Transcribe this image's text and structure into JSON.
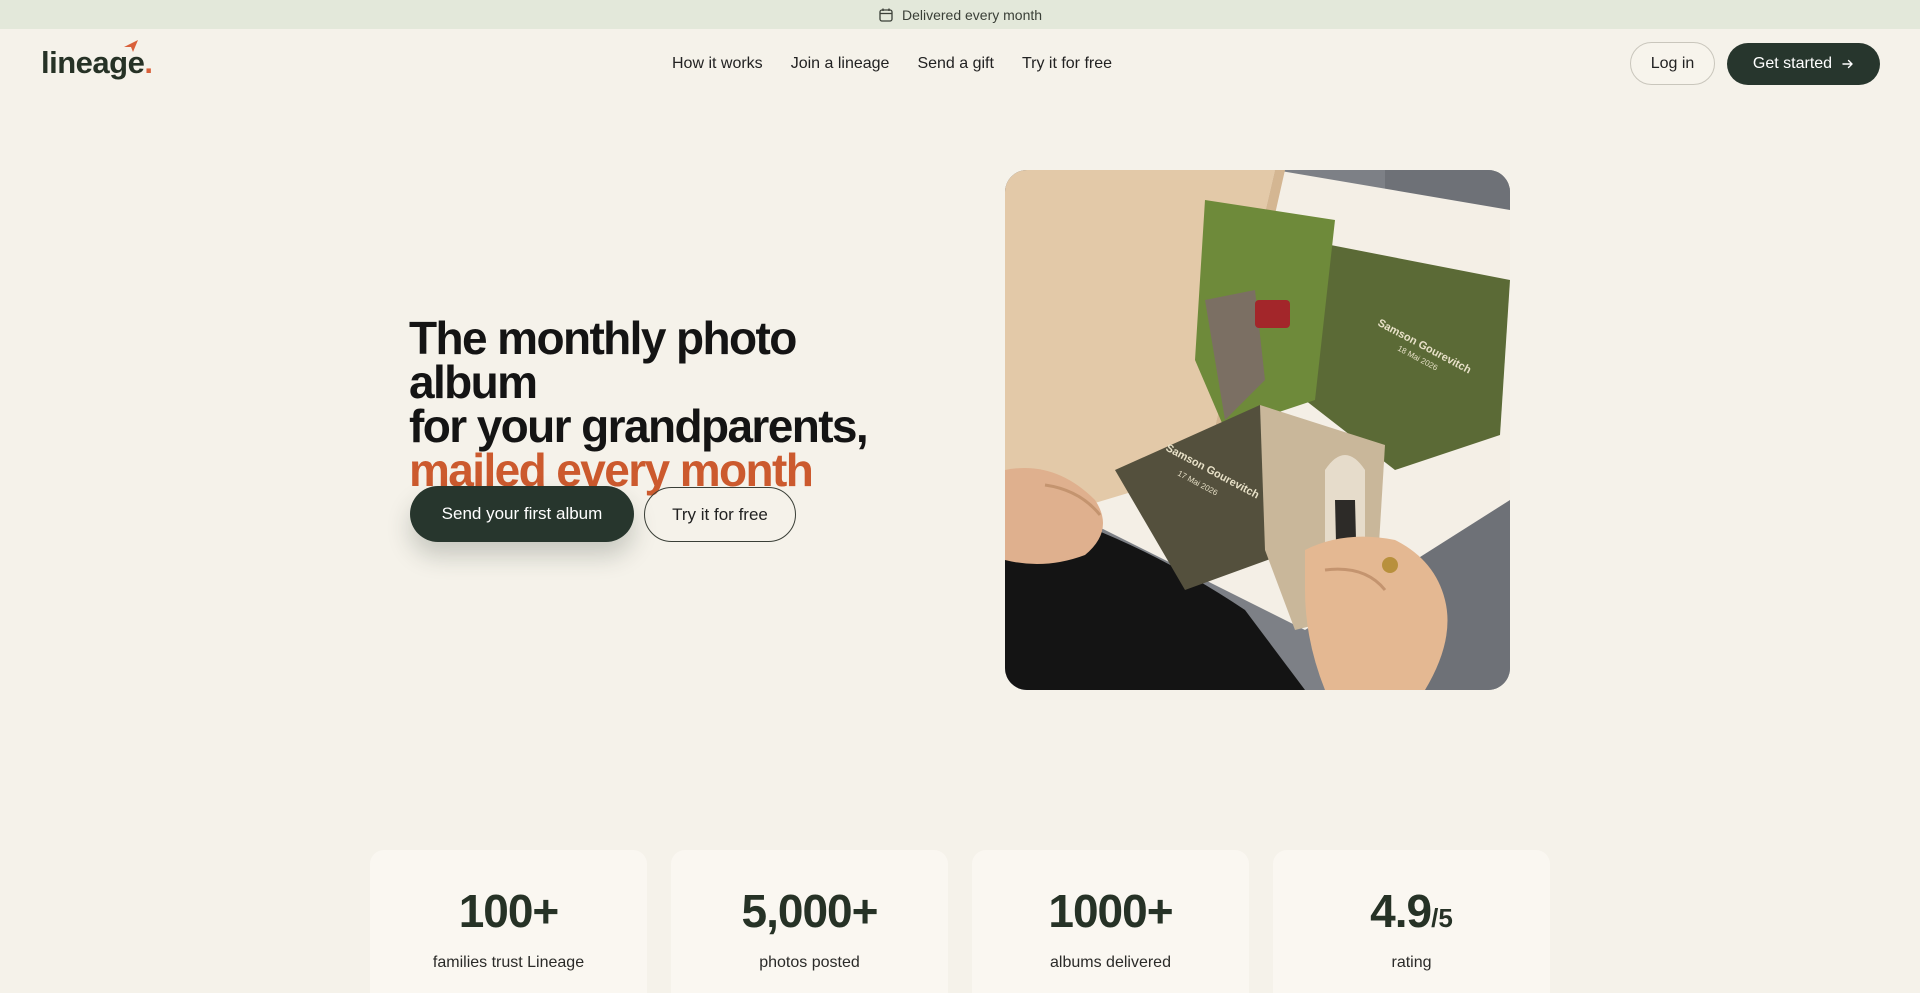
{
  "announcement": {
    "icon": "calendar-icon",
    "text": "Delivered every month"
  },
  "header": {
    "logo_text": "lineage",
    "logo_dot": ".",
    "nav": [
      {
        "label": "How it works"
      },
      {
        "label": "Join a lineage"
      },
      {
        "label": "Send a gift"
      },
      {
        "label": "Try it for free"
      }
    ],
    "login_label": "Log in",
    "get_started_label": "Get started"
  },
  "hero": {
    "title_line1": "The monthly photo album",
    "title_line2": "for your grandparents,",
    "title_accent": "mailed every month",
    "primary_cta": "Send your first album",
    "secondary_cta": "Try it for free",
    "image": {
      "album_name_1": "Samson Gourevitch",
      "album_date_1": "18 Mai 2026",
      "album_name_2": "Samson Gourevitch",
      "album_date_2": "17 Mai 2026"
    }
  },
  "stats": [
    {
      "value": "100+",
      "suffix": "",
      "label": "families trust Lineage"
    },
    {
      "value": "5,000+",
      "suffix": "",
      "label": "photos posted"
    },
    {
      "value": "1000+",
      "suffix": "",
      "label": "albums delivered"
    },
    {
      "value": "4.9",
      "suffix": "/5",
      "label": "rating"
    }
  ],
  "colors": {
    "background": "#f5f2ea",
    "topbar": "#e3e8da",
    "brand_dark": "#27362d",
    "accent": "#cc5a2e",
    "card": "#faf7f1"
  }
}
